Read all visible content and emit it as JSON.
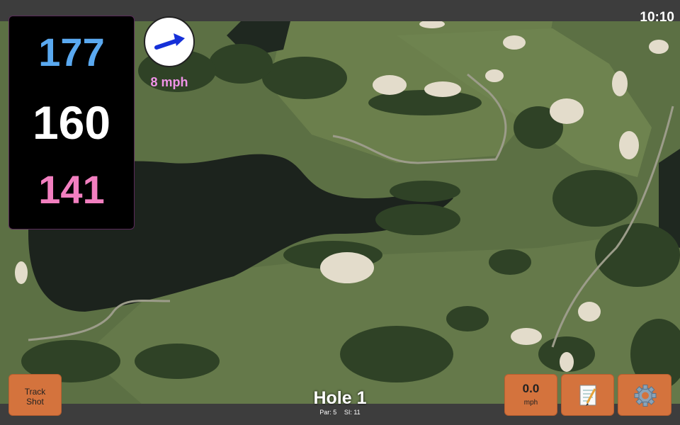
{
  "status": {
    "time": "10:10"
  },
  "distances": {
    "back": "177",
    "middle": "160",
    "front": "141"
  },
  "wind": {
    "speed": "8 mph",
    "icon": "wind-arrow-icon"
  },
  "buttons": {
    "track_shot_line1": "Track",
    "track_shot_line2": "Shot",
    "speed_value": "0.0",
    "speed_unit": "mph",
    "notes_icon": "notepad-icon",
    "settings_icon": "gear-icon"
  },
  "hole": {
    "title": "Hole 1",
    "par": "Par: 5",
    "si": "SI: 11"
  },
  "colors": {
    "back": "#5aa9f0",
    "middle": "#ffffff",
    "front": "#f27fc0",
    "button": "#d4733d",
    "wind_text": "#f093e8"
  }
}
